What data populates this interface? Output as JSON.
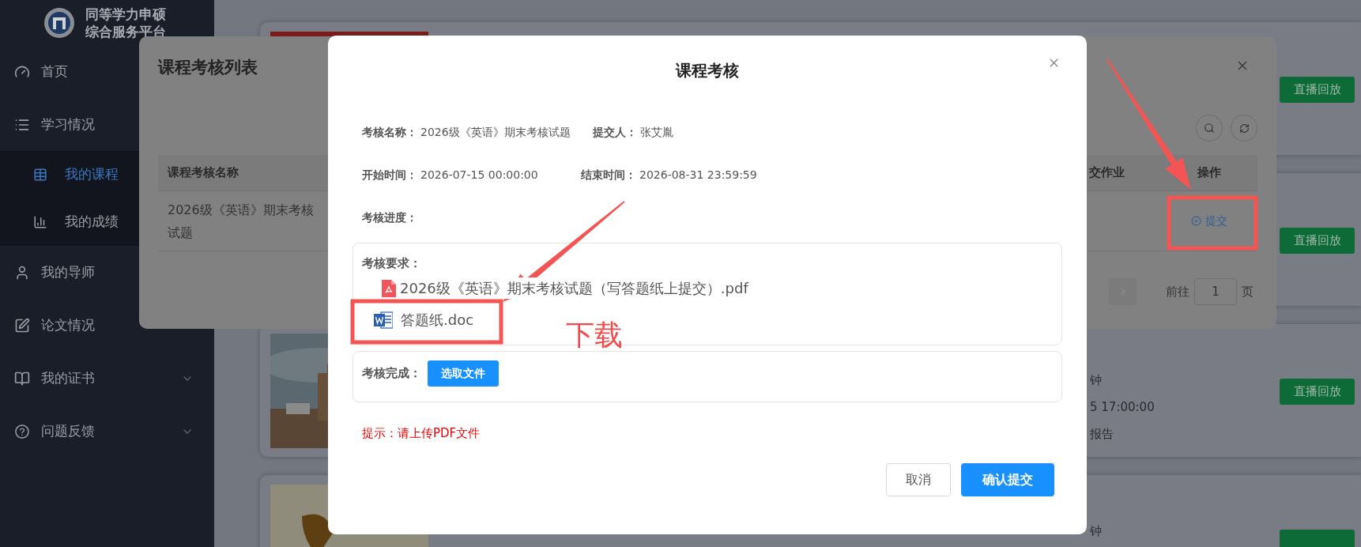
{
  "sidebar": {
    "brand_lines": [
      "同等学力申硕",
      "综合服务平台"
    ],
    "items": [
      {
        "label": "首页",
        "selected": false
      },
      {
        "label": "学习情况",
        "selected": false,
        "expanded": true,
        "children": [
          {
            "label": "我的课程",
            "selected": true
          },
          {
            "label": "我的成绩",
            "selected": false
          }
        ]
      },
      {
        "label": "我的导师",
        "selected": false
      },
      {
        "label": "论文情况",
        "selected": false
      },
      {
        "label": "我的证书",
        "selected": false,
        "expanded": false
      },
      {
        "label": "问题反馈",
        "selected": false,
        "expanded": false
      }
    ]
  },
  "course_cards": [
    {
      "kind": "picture",
      "button": "直播回放"
    },
    {
      "button": "直播回放"
    },
    {
      "kind": "picture",
      "texts": [
        "钟",
        "5 17:00:00",
        "报告"
      ],
      "button": "直播回放"
    },
    {
      "kind": "picture",
      "texts": [
        "钟"
      ]
    }
  ],
  "list_dialog": {
    "title": "课程考核列表",
    "columns": [
      "课程考核名称",
      "交作业",
      "操作"
    ],
    "rows": [
      {
        "name": "2026级《英语》期末考核试题",
        "action": "提交"
      }
    ],
    "pagination": {
      "goto_label": "前往",
      "page_value": "1",
      "page_suffix": "页"
    }
  },
  "dialog": {
    "title": "课程考核",
    "fields": [
      [
        {
          "label": "考核名称：",
          "value": "2026级《英语》期末考核试题"
        },
        {
          "label": "提交人：",
          "value": "张艾胤"
        }
      ],
      [
        {
          "label": "开始时间：",
          "value": "2026-07-15 00:00:00"
        },
        {
          "label": "结束时间：",
          "value": "2026-08-31 23:59:59"
        }
      ],
      [
        {
          "label": "考核进度："
        }
      ]
    ],
    "requirements": {
      "label": "考核要求：",
      "files": [
        {
          "kind": "pdf",
          "name": "2026级《英语》期末考核试题（写答题纸上提交）.pdf"
        },
        {
          "kind": "doc",
          "name": "答题纸.doc"
        }
      ]
    },
    "completion": {
      "label": "考核完成：",
      "button": "选取文件"
    },
    "hint": "提示：请上传PDF文件",
    "buttons": [
      {
        "label": "取消",
        "kind": "default"
      },
      {
        "label": "确认提交",
        "kind": "primary"
      }
    ]
  },
  "annotation": {
    "label": "下载"
  }
}
